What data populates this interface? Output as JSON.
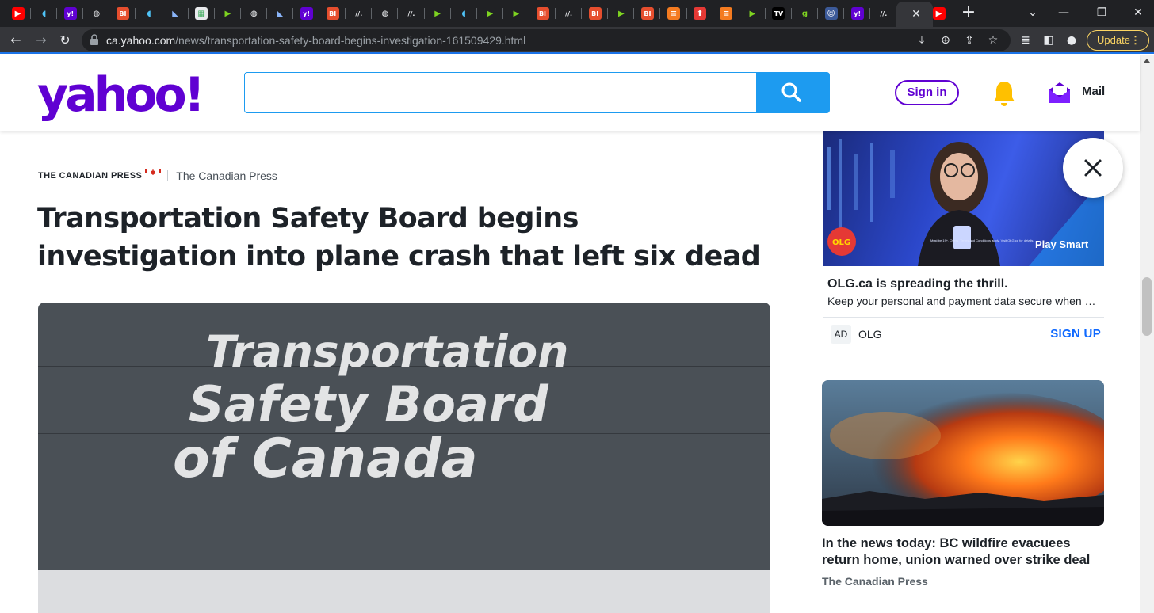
{
  "browser": {
    "tabs": [
      {
        "icon": "youtube-icon",
        "glyph": "▶",
        "bg": "#ff0000"
      },
      {
        "icon": "shield-icon",
        "glyph": "◖",
        "bg": "#202124",
        "fg": "#4fc3f7"
      },
      {
        "icon": "yahoo-icon",
        "glyph": "y!",
        "bg": "#6001d2"
      },
      {
        "icon": "globe-icon",
        "glyph": "◍",
        "bg": "#202124",
        "fg": "#e8eaed"
      },
      {
        "icon": "business-insider-icon",
        "glyph": "BI",
        "bg": "#e64e2e"
      },
      {
        "icon": "shield-icon",
        "glyph": "◖",
        "bg": "#202124",
        "fg": "#4fc3f7"
      },
      {
        "icon": "bookmark-icon",
        "glyph": "◣",
        "bg": "#202124",
        "fg": "#8ab4f8"
      },
      {
        "icon": "image-icon",
        "glyph": "▦",
        "bg": "#e8eaed",
        "fg": "#34a853"
      },
      {
        "icon": "play-icon",
        "glyph": "▶",
        "bg": "#202124",
        "fg": "#7ed321"
      },
      {
        "icon": "globe-icon",
        "glyph": "◍",
        "bg": "#202124",
        "fg": "#e8eaed"
      },
      {
        "icon": "bookmark-icon",
        "glyph": "◣",
        "bg": "#202124",
        "fg": "#8ab4f8"
      },
      {
        "icon": "yahoo-icon",
        "glyph": "y!",
        "bg": "#6001d2"
      },
      {
        "icon": "business-insider-icon",
        "glyph": "BI",
        "bg": "#e64e2e"
      },
      {
        "icon": "wide-news-icon",
        "glyph": "//.",
        "bg": "#202124",
        "fg": "#e8eaed"
      },
      {
        "icon": "globe-icon",
        "glyph": "◍",
        "bg": "#202124",
        "fg": "#e8eaed"
      },
      {
        "icon": "wide-news-icon",
        "glyph": "//.",
        "bg": "#202124",
        "fg": "#e8eaed"
      },
      {
        "icon": "play-icon",
        "glyph": "▶",
        "bg": "#202124",
        "fg": "#7ed321"
      },
      {
        "icon": "shield-icon",
        "glyph": "◖",
        "bg": "#202124",
        "fg": "#4fc3f7"
      },
      {
        "icon": "play-icon",
        "glyph": "▶",
        "bg": "#202124",
        "fg": "#7ed321"
      },
      {
        "icon": "play-icon",
        "glyph": "▶",
        "bg": "#202124",
        "fg": "#7ed321"
      },
      {
        "icon": "business-insider-icon",
        "glyph": "BI",
        "bg": "#e64e2e"
      },
      {
        "icon": "wide-news-icon",
        "glyph": "//.",
        "bg": "#202124",
        "fg": "#e8eaed"
      },
      {
        "icon": "business-insider-icon",
        "glyph": "BI",
        "bg": "#e64e2e"
      },
      {
        "icon": "play-icon",
        "glyph": "▶",
        "bg": "#202124",
        "fg": "#7ed321"
      },
      {
        "icon": "business-insider-icon",
        "glyph": "BI",
        "bg": "#e64e2e"
      },
      {
        "icon": "stack-icon",
        "glyph": "≡",
        "bg": "#f47b20"
      },
      {
        "icon": "upload-icon",
        "glyph": "⬆",
        "bg": "#e53935"
      },
      {
        "icon": "stack-icon",
        "glyph": "≡",
        "bg": "#f47b20"
      },
      {
        "icon": "play-icon",
        "glyph": "▶",
        "bg": "#202124",
        "fg": "#7ed321"
      },
      {
        "icon": "tv-icon",
        "glyph": "TV",
        "bg": "#000000"
      },
      {
        "icon": "g-icon",
        "glyph": "g",
        "bg": "#202124",
        "fg": "#7ed321"
      },
      {
        "icon": "person-icon",
        "glyph": "☺",
        "bg": "#3c5a99"
      },
      {
        "icon": "yahoo-icon",
        "glyph": "y!",
        "bg": "#6001d2"
      },
      {
        "icon": "wide-news-icon",
        "glyph": "//.",
        "bg": "#202124",
        "fg": "#e8eaed"
      }
    ],
    "active_tab_close": "✕",
    "extra_tab": {
      "icon": "youtube-icon",
      "glyph": "▶",
      "bg": "#ff0000"
    },
    "new_tab": "+",
    "window_controls": {
      "dropdown": "⌄",
      "minimize": "—",
      "restore": "❐",
      "close": "✕"
    },
    "url_host": "ca.yahoo.com",
    "url_path": "/news/transportation-safety-board-begins-investigation-161509429.html",
    "update_label": "Update",
    "update_menu": "⋮"
  },
  "header": {
    "logo": "yahoo!",
    "search_placeholder": "",
    "signin_label": "Sign in",
    "mail_label": "Mail"
  },
  "article": {
    "publisher_logo": "THE CANADIAN PRESS",
    "author": "The Canadian Press",
    "headline": "Transportation Safety Board begins investigation into plane crash that left six dead",
    "hero_sign": [
      "Transportation",
      "Safety Board",
      "of Canada"
    ]
  },
  "ad": {
    "brand_logo": "OLG",
    "tagline": "Play Smart",
    "fine_print": "Must be 19+. Offers, Terms and Conditions apply. Visit OLG.ca for details.",
    "title": "OLG.ca is spreading the thrill.",
    "description": "Keep your personal and payment data secure when you play",
    "badge": "AD",
    "sponsor": "OLG",
    "cta": "SIGN UP"
  },
  "related": {
    "title": "In the news today: BC wildfire evacuees return home, union warned over strike deal",
    "source": "The Canadian Press"
  },
  "colors": {
    "yahoo_purple": "#6001d2",
    "search_blue": "#1d9bf0",
    "link_blue": "#0f69ff",
    "text_dark": "#1d2228",
    "chrome_dark": "#202124",
    "chrome_toolbar": "#35363a"
  }
}
